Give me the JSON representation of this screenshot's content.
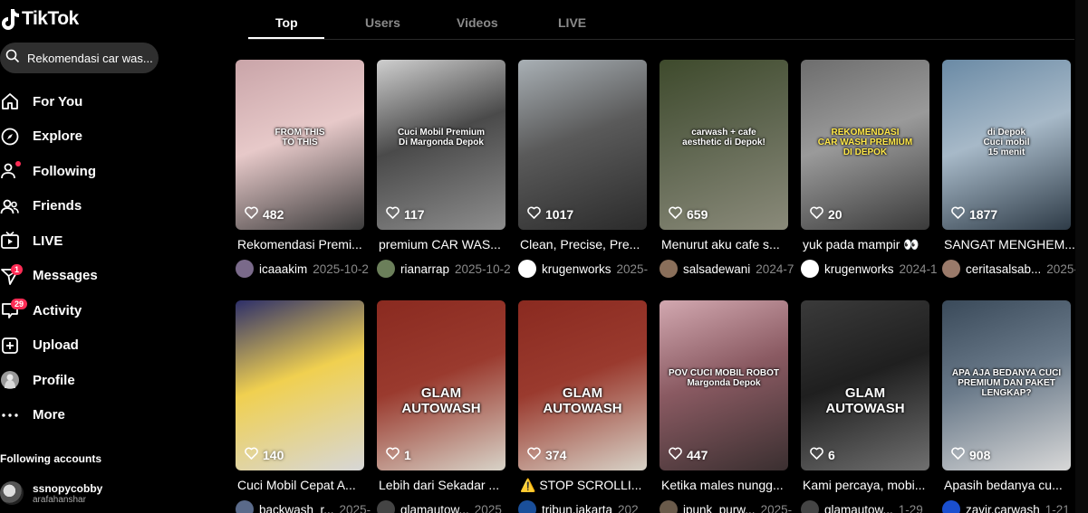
{
  "app": {
    "name": "TikTok"
  },
  "search": {
    "query": "Rekomendasi car was..."
  },
  "nav": [
    {
      "id": "for-you",
      "label": "For You",
      "icon": "home-icon"
    },
    {
      "id": "explore",
      "label": "Explore",
      "icon": "compass-icon"
    },
    {
      "id": "following",
      "label": "Following",
      "icon": "user-follow-icon"
    },
    {
      "id": "friends",
      "label": "Friends",
      "icon": "friends-icon"
    },
    {
      "id": "live",
      "label": "LIVE",
      "icon": "live-tv-icon"
    },
    {
      "id": "messages",
      "label": "Messages",
      "icon": "send-icon",
      "badge": "1"
    },
    {
      "id": "activity",
      "label": "Activity",
      "icon": "inbox-icon",
      "badge": "29"
    },
    {
      "id": "upload",
      "label": "Upload",
      "icon": "plus-square-icon"
    },
    {
      "id": "profile",
      "label": "Profile",
      "icon": "profile-avatar-icon"
    },
    {
      "id": "more",
      "label": "More",
      "icon": "more-dots-icon"
    }
  ],
  "following_accounts": {
    "title": "Following accounts",
    "accounts": [
      {
        "name": "ssnopycobby",
        "handle": "arafahanshar"
      }
    ]
  },
  "tabs": [
    {
      "label": "Top",
      "active": true
    },
    {
      "label": "Users",
      "active": false
    },
    {
      "label": "Videos",
      "active": false
    },
    {
      "label": "LIVE",
      "active": false
    }
  ],
  "videos": [
    {
      "likes": "482",
      "desc": "Rekomendasi Premi...",
      "user": "icaaakim",
      "date": "2025-10-2",
      "overlay": "FROM THIS\nTO THIS",
      "colors": [
        "#c9a4a8",
        "#3b3b3b",
        "#e7c9c9"
      ],
      "avatar": "#7a6a8a"
    },
    {
      "likes": "117",
      "desc": "premium CAR WAS...",
      "user": "rianarrap",
      "date": "2025-10-2",
      "overlay": "Cuci Mobil Premium\nDi Margonda Depok",
      "colors": [
        "#cfcfcf",
        "#8d8d8d",
        "#4a4a4a"
      ],
      "avatar": "#6b7f5a"
    },
    {
      "likes": "1017",
      "desc": "Clean, Precise, Pre...",
      "user": "krugenworks",
      "date": "2025-",
      "overlay": "",
      "colors": [
        "#a9b0b5",
        "#2b2b2b",
        "#5a5a5a"
      ],
      "avatar": "#ffffff"
    },
    {
      "likes": "659",
      "desc": "Menurut aku cafe s...",
      "user": "salsadewani",
      "date": "2024-7",
      "overlay": "carwash + cafe\naesthetic di Depok!",
      "colors": [
        "#3e4a2c",
        "#8a8a7a",
        "#5f6650"
      ],
      "avatar": "#8a6f5a"
    },
    {
      "likes": "20",
      "desc": "yuk pada mampir 👀",
      "user": "krugenworks",
      "date": "2024-1",
      "overlay": "REKOMENDASI\nCAR WASH PREMIUM\nDI DEPOK",
      "colors": [
        "#6d6d6d",
        "#3a3a3a",
        "#9a9a9a"
      ],
      "avatar": "#ffffff"
    },
    {
      "likes": "1877",
      "desc": "SANGAT MENGHEM...",
      "user": "ceritasalsab...",
      "date": "2025-",
      "overlay": "di Depok\nCuci mobil\n15 menit",
      "colors": [
        "#6a8aa5",
        "#2e3b47",
        "#a7b9c8"
      ],
      "avatar": "#9a7a6a"
    },
    {
      "likes": "140",
      "desc": "Cuci Mobil Cepat A...",
      "user": "backwash_r...",
      "date": "2025-",
      "overlay": "",
      "colors": [
        "#2d2f6a",
        "#d7d7d7",
        "#f0d050"
      ],
      "avatar": "#5a6a8a"
    },
    {
      "likes": "1",
      "desc": "Lebih dari Sekadar ...",
      "user": "glamautow...",
      "date": "2025",
      "overlay": "GLAM\nAUTOWASH",
      "colors": [
        "#8a2a20",
        "#d8d3c8",
        "#9a3a2e"
      ],
      "avatar": "#444444"
    },
    {
      "likes": "374",
      "desc": "⚠️ STOP SCROLLI...",
      "user": "tribun.jakarta",
      "date": "202",
      "overlay": "GLAM\nAUTOWASH",
      "colors": [
        "#8a2a20",
        "#d8d3c8",
        "#9a3a2e"
      ],
      "avatar": "#1a4f9a"
    },
    {
      "likes": "447",
      "desc": "Ketika males nungg...",
      "user": "ipunk_purw...",
      "date": "2025-",
      "overlay": "POV CUCI MOBIL ROBOT\nMargonda Depok",
      "colors": [
        "#d2a8b0",
        "#3a2f30",
        "#8a5a62"
      ],
      "avatar": "#6a5a4a"
    },
    {
      "likes": "6",
      "desc": "Kami percaya, mobi...",
      "user": "glamautow...",
      "date": "1-29",
      "overlay": "GLAM\nAUTOWASH",
      "colors": [
        "#3a3a3a",
        "#707070",
        "#1f1f1f"
      ],
      "avatar": "#444444"
    },
    {
      "likes": "908",
      "desc": "Apasih bedanya cu...",
      "user": "zavir.carwash",
      "date": "1-21",
      "overlay": "APA AJA BEDANYA CUCI\nPREMIUM DAN PAKET\nLENGKAP?",
      "colors": [
        "#3a4a5a",
        "#d8d8d8",
        "#6a7a8a"
      ],
      "avatar": "#1a4fcf"
    }
  ],
  "accent": "#fe2c55"
}
